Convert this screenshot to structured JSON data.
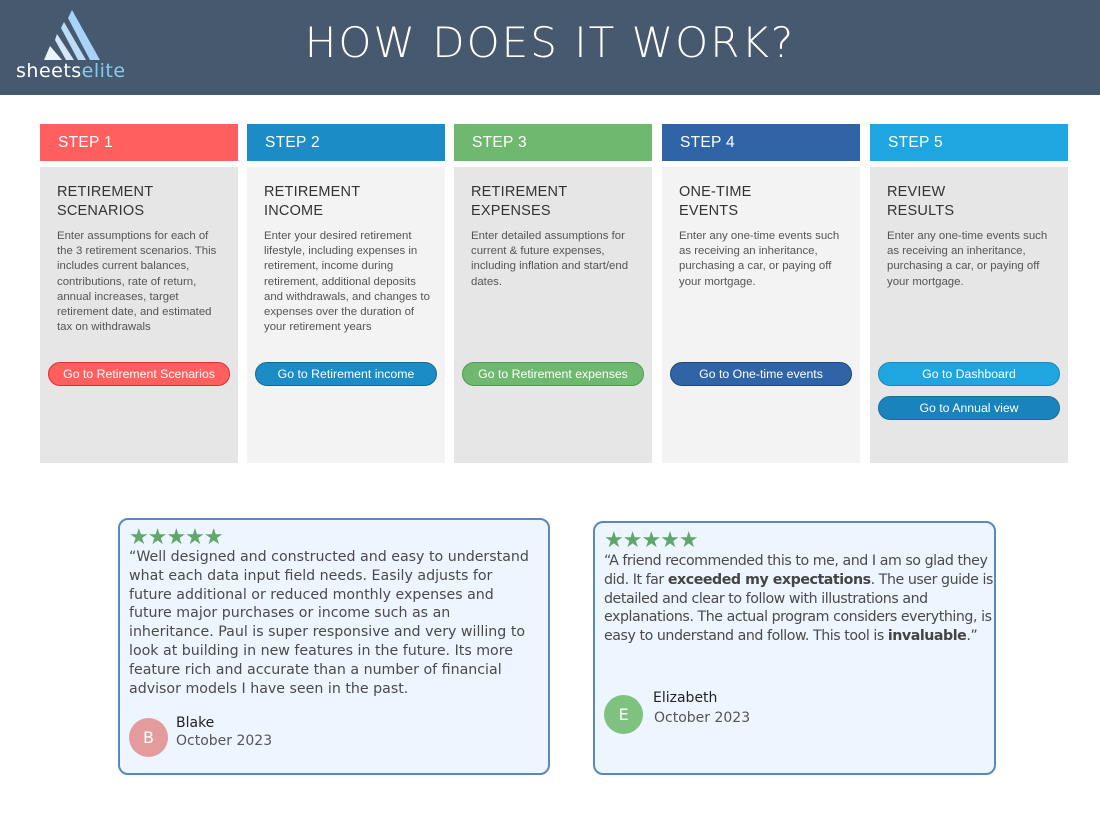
{
  "header": {
    "logo_text_primary": "sheets",
    "logo_text_accent": "elite",
    "title": "HOW DOES IT WORK?"
  },
  "colors": {
    "header_bg": "#47596e",
    "step1": "#ff5f5f",
    "step2": "#1b8cc5",
    "step3": "#6eb96f",
    "step4": "#2f65a7",
    "step5": "#1fa6e0",
    "review_border": "#5b87bf",
    "star": "#5fa76b"
  },
  "steps": [
    {
      "label": "STEP 1",
      "title_line1": "RETIREMENT",
      "title_line2": "SCENARIOS",
      "description": "Enter assumptions for each of the 3 retirement scenarios.  This includes current balances, contributions, rate of return, annual increases, target retirement date, and estimated tax on withdrawals",
      "buttons": [
        "Go to Retirement Scenarios"
      ]
    },
    {
      "label": "STEP 2",
      "title_line1": "RETIREMENT",
      "title_line2": "INCOME",
      "description": "Enter your desired retirement lifestyle, including expenses in retirement, income during retirement, additional deposits and withdrawals, and changes to expenses over the duration of your retirement years",
      "buttons": [
        "Go to Retirement income"
      ]
    },
    {
      "label": "STEP 3",
      "title_line1": "RETIREMENT",
      "title_line2": "EXPENSES",
      "description": "Enter detailed assumptions for current & future expenses, including inflation and start/end dates.",
      "buttons": [
        "Go to Retirement expenses"
      ]
    },
    {
      "label": "STEP 4",
      "title_line1": "ONE-TIME",
      "title_line2": "EVENTS",
      "description": "Enter any one-time events such as receiving an inheritance, purchasing a car, or paying off your mortgage.",
      "buttons": [
        "Go to One-time events"
      ]
    },
    {
      "label": "STEP 5",
      "title_line1": "REVIEW",
      "title_line2": "RESULTS",
      "description": "Enter any one-time events  such as receiving an inheritance, purchasing a car, or paying off your mortgage.",
      "buttons": [
        "Go to Dashboard",
        "Go to Annual view"
      ]
    }
  ],
  "reviews": [
    {
      "rating": 5,
      "stars": "★★★★★",
      "text_parts": [
        {
          "t": "“Well designed and constructed and easy to understand what each data input field needs. Easily adjusts for future additional or reduced monthly expenses and future major purchases or income such as an inheritance. Paul is super responsive and very willing to look at building in new features in the future. Its more feature rich and accurate than a number of financial advisor models I have seen in the past.",
          "bold": false
        }
      ],
      "initial": "B",
      "name": "Blake",
      "date": "October 2023"
    },
    {
      "rating": 5,
      "stars": "★★★★★",
      "text_parts": [
        {
          "t": "“A friend recommended this to me, and I am so glad they did. It far ",
          "bold": false
        },
        {
          "t": "exceeded my expectations",
          "bold": true
        },
        {
          "t": ". The user guide is detailed and clear to follow with illustrations and explanations. The actual program considers everything, is easy to understand and follow. This tool is ",
          "bold": false
        },
        {
          "t": "invaluable",
          "bold": true
        },
        {
          "t": ".”",
          "bold": false
        }
      ],
      "initial": "E",
      "name": "Elizabeth",
      "date": "October 2023"
    }
  ]
}
